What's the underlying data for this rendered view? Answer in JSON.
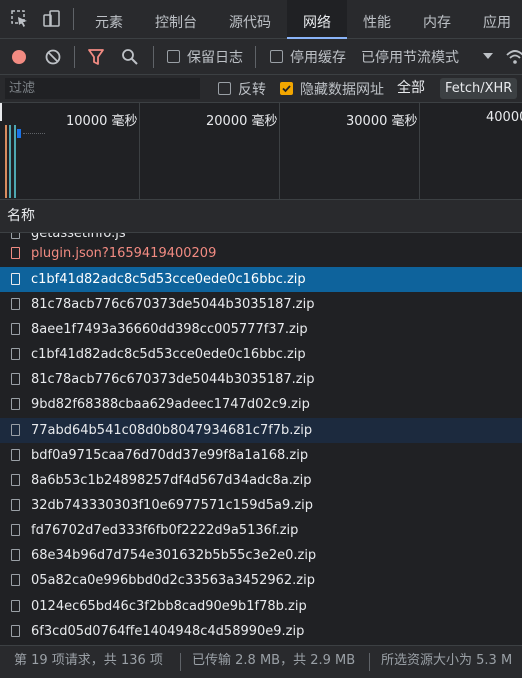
{
  "tabs": [
    "元素",
    "控制台",
    "源代码",
    "网络",
    "性能",
    "内存",
    "应用"
  ],
  "active_tab": "网络",
  "toolbar": {
    "preserve_log": "保留日志",
    "disable_cache": "停用缓存",
    "throttling": "已停用节流模式"
  },
  "filter": {
    "placeholder": "过滤",
    "invert_label": "反转",
    "hide_data_urls_label": "隐藏数据网址",
    "all_label": "全部",
    "fetch_xhr_label": "Fetch/XHR"
  },
  "timeline": {
    "ticks": [
      "10000 毫秒",
      "20000 毫秒",
      "30000 毫秒",
      "40000"
    ]
  },
  "list_header": "名称",
  "requests": [
    {
      "name": "getassetinfo.js",
      "state": "partial"
    },
    {
      "name": "plugin.json?1659419400209",
      "state": "error"
    },
    {
      "name": "c1bf41d82adc8c5d53cce0ede0c16bbc.zip",
      "state": "selected"
    },
    {
      "name": "81c78acb776c670373de5044b3035187.zip",
      "state": "normal"
    },
    {
      "name": "8aee1f7493a36660dd398cc005777f37.zip",
      "state": "normal"
    },
    {
      "name": "c1bf41d82adc8c5d53cce0ede0c16bbc.zip",
      "state": "normal"
    },
    {
      "name": "81c78acb776c670373de5044b3035187.zip",
      "state": "normal"
    },
    {
      "name": "9bd82f68388cbaa629adeec1747d02c9.zip",
      "state": "normal"
    },
    {
      "name": "77abd64b541c08d0b8047934681c7f7b.zip",
      "state": "hover"
    },
    {
      "name": "bdf0a9715caa76d70dd37e99f8a1a168.zip",
      "state": "normal"
    },
    {
      "name": "8a6b53c1b24898257df4d567d34adc8a.zip",
      "state": "normal"
    },
    {
      "name": "32db743330303f10e6977571c159d5a9.zip",
      "state": "normal"
    },
    {
      "name": "fd76702d7ed333f6fb0f2222d9a5136f.zip",
      "state": "normal"
    },
    {
      "name": "68e34b96d7d754e301632b5b55c3e2e0.zip",
      "state": "normal"
    },
    {
      "name": "05a82ca0e996bbd0d2c33563a3452962.zip",
      "state": "normal"
    },
    {
      "name": "0124ec65bd46c3f2bb8cad90e9b1f78b.zip",
      "state": "normal"
    },
    {
      "name": "6f3cd05d0764ffe1404948c4d58990e9.zip",
      "state": "normal"
    }
  ],
  "status": {
    "requests": "第 19 项请求，共 136 项",
    "transferred": "已传输 2.8 MB，共 2.9 MB",
    "selected_size": "所选资源大小为 5.3 M"
  },
  "colors": {
    "accent": "#8ab4f8",
    "selected_row": "#0e639c",
    "hover_row": "#1c2a3e",
    "error_text": "#f28b82",
    "record": "#f28b82",
    "checkbox_on": "#f2a600"
  }
}
